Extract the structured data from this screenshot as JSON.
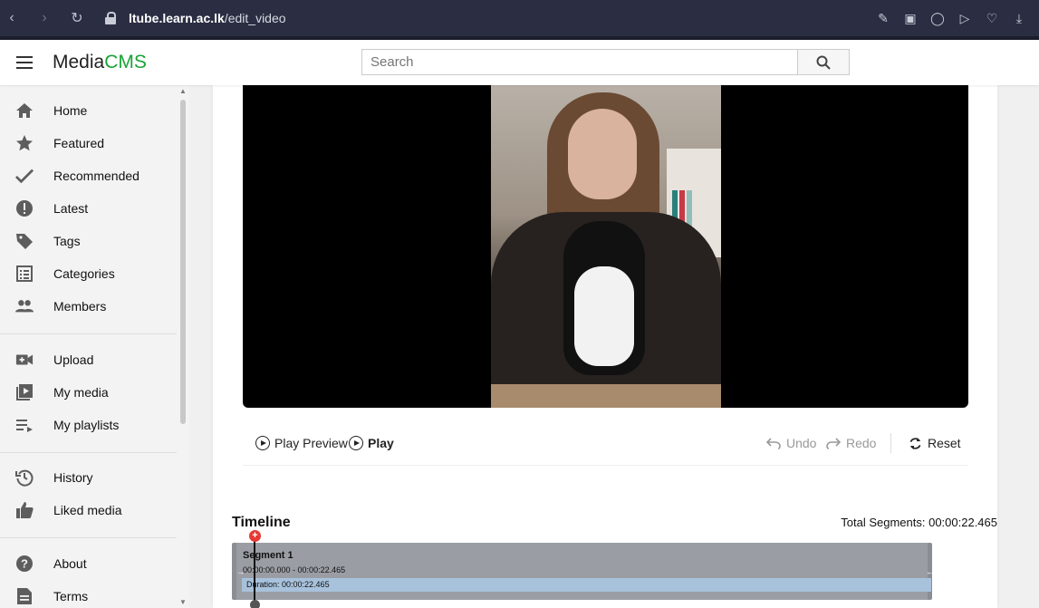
{
  "browser": {
    "url_host": "ltube.learn.ac.lk",
    "url_path": "/edit_video"
  },
  "header": {
    "logo_media": "Media",
    "logo_cms": "CMS",
    "search_placeholder": "Search"
  },
  "sidebar": {
    "items": [
      {
        "label": "Home",
        "icon": "home-icon"
      },
      {
        "label": "Featured",
        "icon": "star-icon"
      },
      {
        "label": "Recommended",
        "icon": "check-icon"
      },
      {
        "label": "Latest",
        "icon": "badge-icon"
      },
      {
        "label": "Tags",
        "icon": "tag-icon"
      },
      {
        "label": "Categories",
        "icon": "list-icon"
      },
      {
        "label": "Members",
        "icon": "people-icon"
      },
      {
        "label": "Upload",
        "icon": "video-add-icon"
      },
      {
        "label": "My media",
        "icon": "media-library-icon"
      },
      {
        "label": "My playlists",
        "icon": "playlist-icon"
      },
      {
        "label": "History",
        "icon": "history-icon"
      },
      {
        "label": "Liked media",
        "icon": "thumb-up-icon"
      },
      {
        "label": "About",
        "icon": "help-icon"
      },
      {
        "label": "Terms",
        "icon": "document-icon"
      }
    ]
  },
  "controls": {
    "play_preview": "Play Preview",
    "play": "Play",
    "undo": "Undo",
    "redo": "Redo",
    "reset": "Reset"
  },
  "timeline": {
    "title": "Timeline",
    "total_segments": "Total Segments: 00:00:22.465",
    "segment": {
      "name": "Segment 1",
      "range": "00:00:00.000 - 00:00:22.465",
      "duration": "Duration: 00:00:22.465"
    }
  },
  "colors": {
    "brand_green": "#1aa336",
    "browser_bar": "#2b2e42",
    "marker_red": "#e53935"
  }
}
